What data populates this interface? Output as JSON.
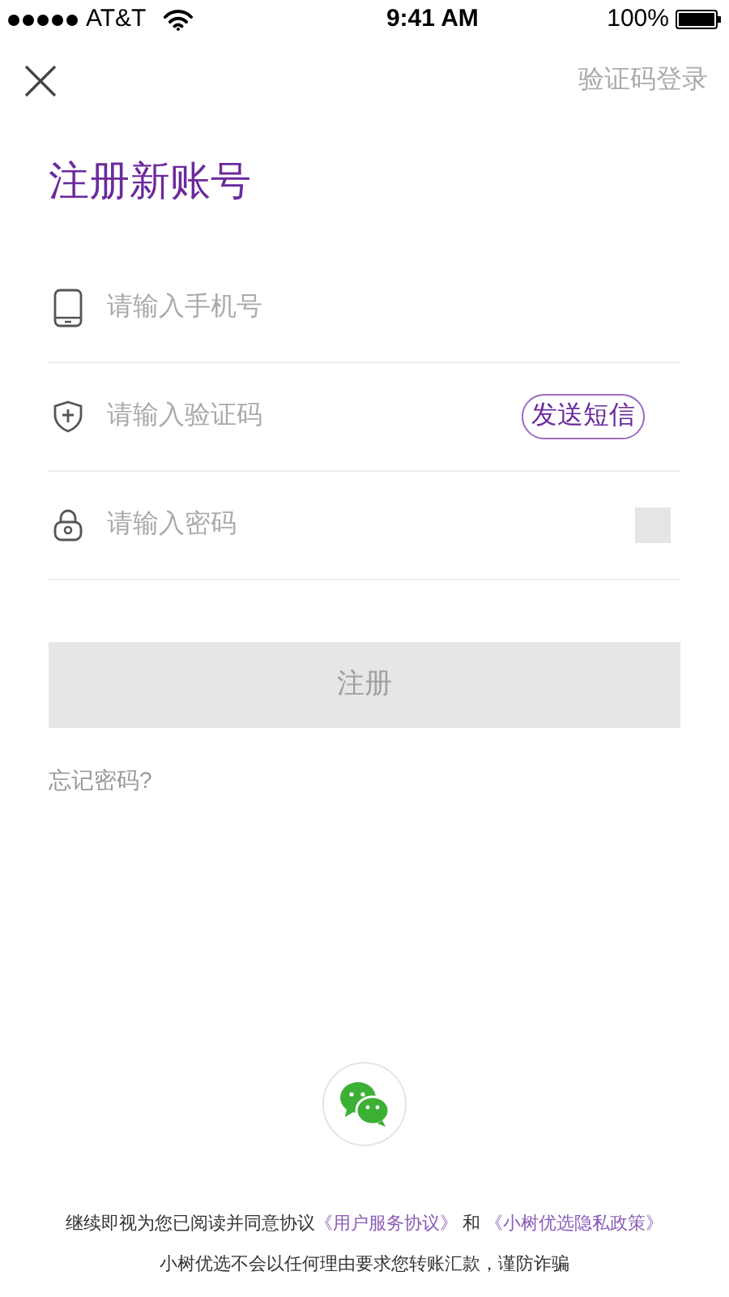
{
  "status_bar": {
    "carrier": "AT&T",
    "time": "9:41 AM",
    "battery": "100%"
  },
  "nav": {
    "right_link": "验证码登录"
  },
  "title": "注册新账号",
  "fields": [
    {
      "kind": "phone",
      "placeholder": "请输入手机号"
    },
    {
      "kind": "code",
      "placeholder": "请输入验证码",
      "action": "发送短信"
    },
    {
      "kind": "password",
      "placeholder": "请输入密码"
    }
  ],
  "submit": {
    "label": "注册",
    "disabled": true
  },
  "forgot_link": "忘记密码?",
  "agreement": {
    "text": "继续即视为您已阅读并同意协议",
    "link_1": "《用户服务协议》",
    "conjunction": "和",
    "link_2": "《小树优选隐私政策》"
  },
  "warning": "小树优选不会以任何理由要求您转账汇款，谨防诈骗"
}
